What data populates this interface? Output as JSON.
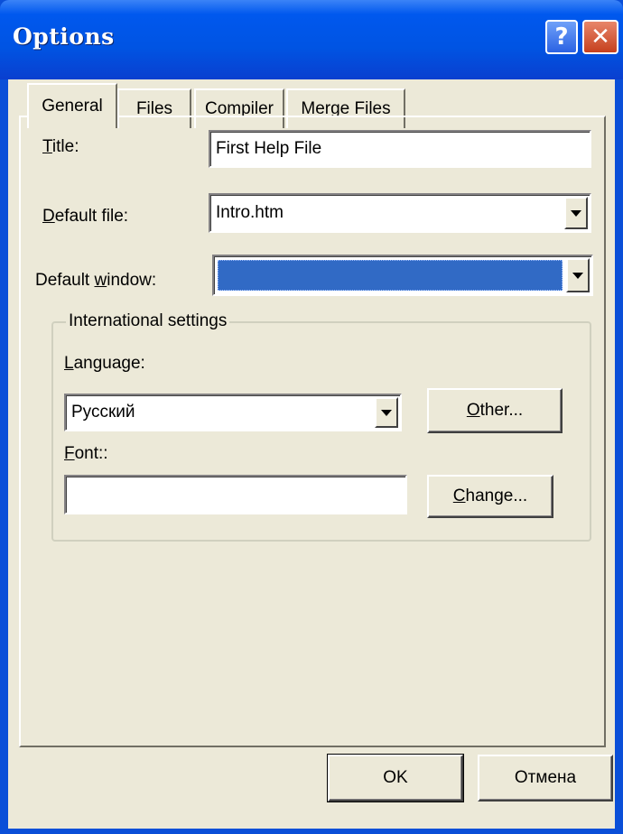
{
  "window": {
    "title": "Options",
    "help_glyph": "?",
    "close_glyph": "✕"
  },
  "tabs": [
    {
      "label": "General",
      "active": true
    },
    {
      "label": "Files",
      "active": false
    },
    {
      "label": "Compiler",
      "active": false
    },
    {
      "label": "Merge Files",
      "active": false
    }
  ],
  "general": {
    "title_label_mnemonic": "T",
    "title_label_rest": "itle:",
    "title_value": "First Help File",
    "default_file_label_mnemonic": "D",
    "default_file_label_rest": "efault file:",
    "default_file_value": "Intro.htm",
    "default_window_label_pre": "Default ",
    "default_window_label_mnemonic": "w",
    "default_window_label_rest": "indow:",
    "default_window_value": ""
  },
  "international": {
    "group_label": "International settings",
    "language_label_mnemonic": "L",
    "language_label_rest": "anguage:",
    "language_value": "Русский",
    "other_mnemonic": "O",
    "other_rest": "ther...",
    "font_label_mnemonic": "F",
    "font_label_rest": "ont::",
    "font_value": "",
    "change_mnemonic": "C",
    "change_rest": "hange..."
  },
  "footer": {
    "ok_label": "OK",
    "cancel_label": "Отмена"
  },
  "colors": {
    "titlebar": "#0054e3",
    "dialog_bg": "#ece9d8",
    "selection": "#316ac5",
    "close_button": "#c6401e"
  }
}
